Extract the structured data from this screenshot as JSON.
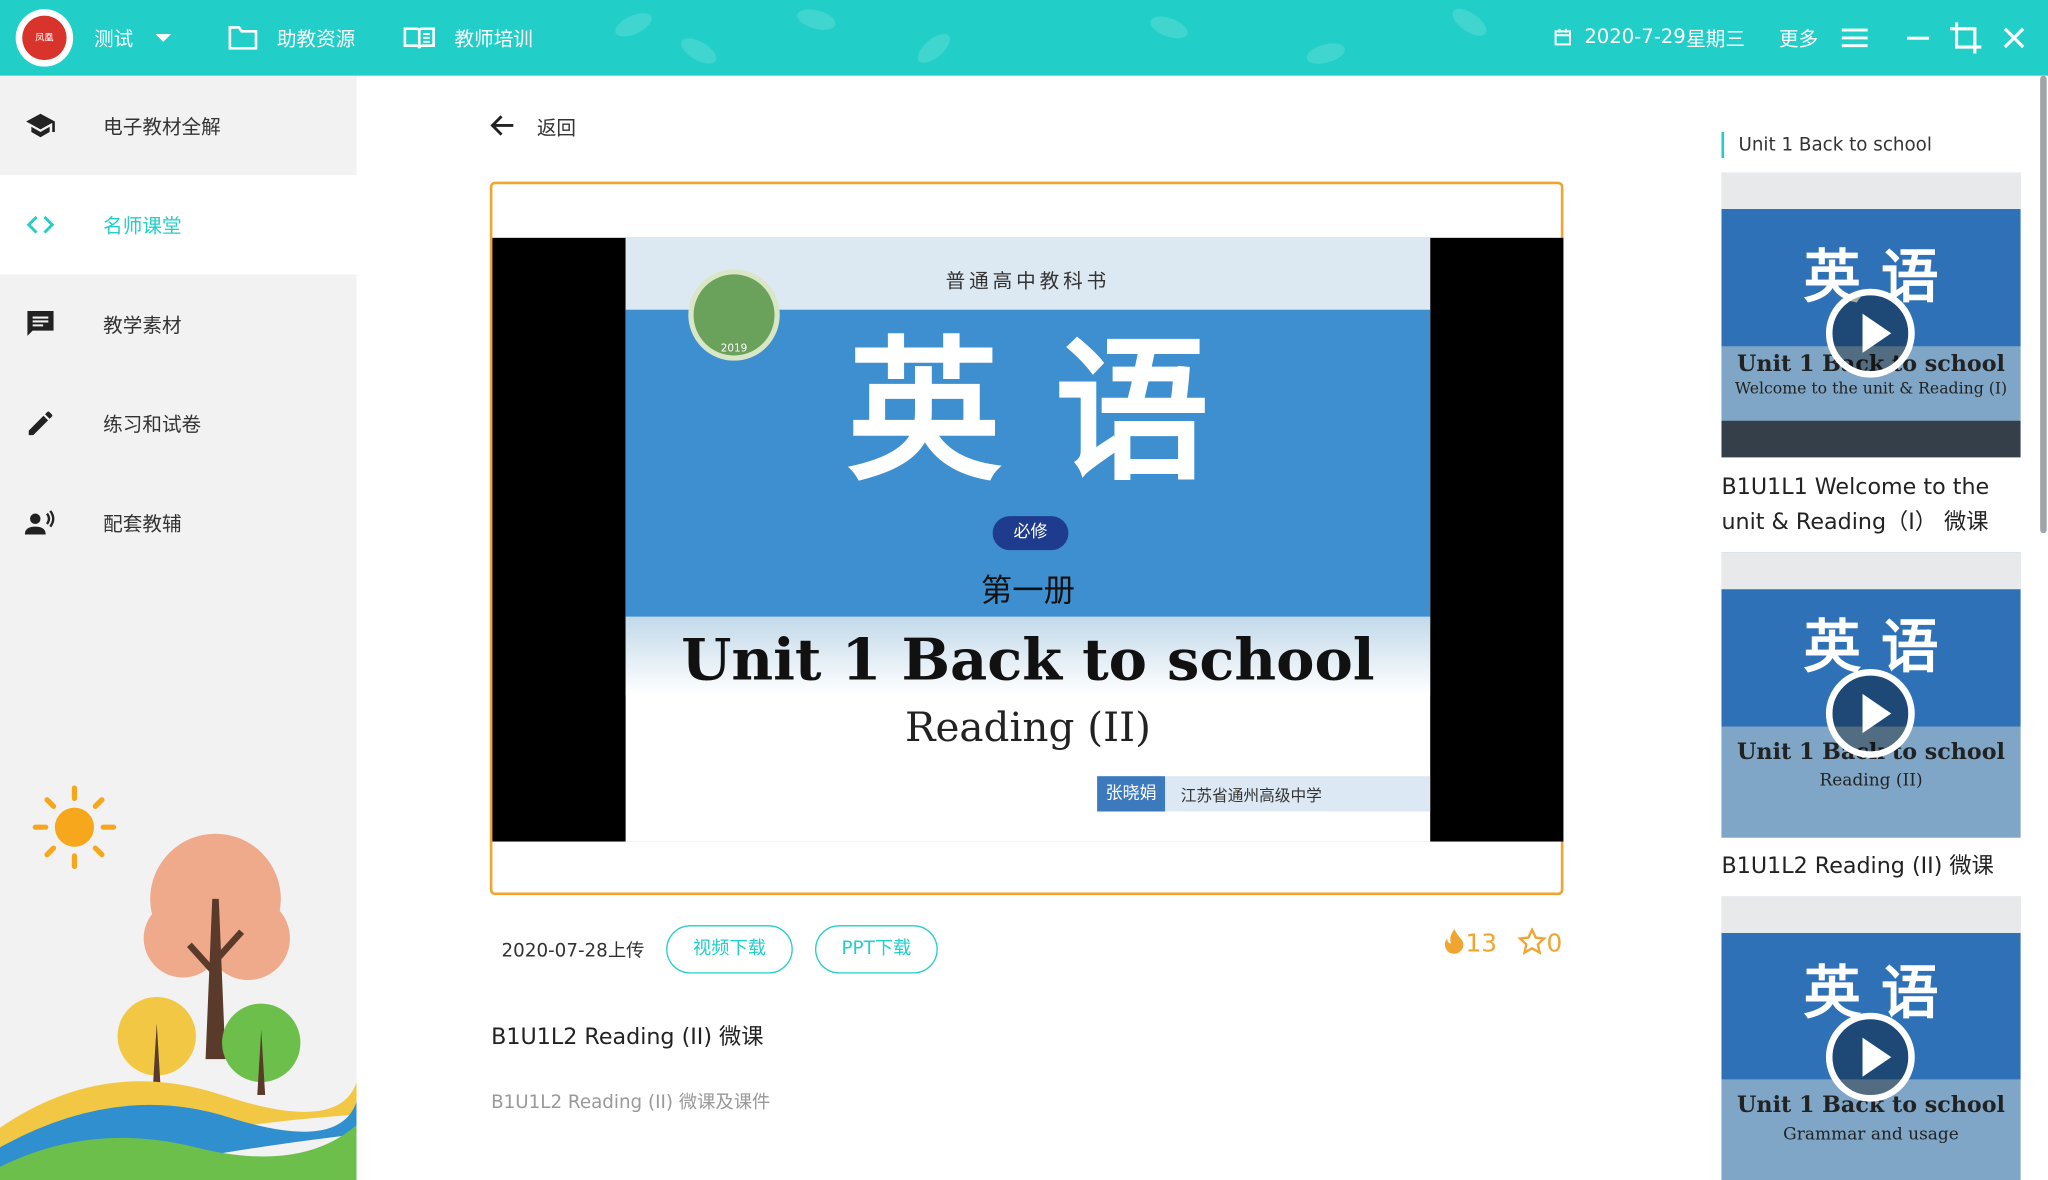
{
  "topbar": {
    "school_select": "测试",
    "resources_label": "助教资源",
    "training_label": "教师培训",
    "date": "2020-7-29",
    "weekday": "星期三",
    "more_label": "更多"
  },
  "sidebar": {
    "items": [
      {
        "label": "电子教材全解",
        "icon": "graduation-cap-icon"
      },
      {
        "label": "名师课堂",
        "icon": "code-brackets-icon"
      },
      {
        "label": "教学素材",
        "icon": "chat-bubble-icon"
      },
      {
        "label": "练习和试卷",
        "icon": "pencil-icon"
      },
      {
        "label": "配套教辅",
        "icon": "speaking-person-icon"
      }
    ],
    "active_index": 1
  },
  "main": {
    "back_label": "返回",
    "slide": {
      "header": "普通高中教科书",
      "subject": "英 语",
      "badge": "必修",
      "volume": "第一册",
      "unit_title": "Unit 1 Back to school",
      "lesson": "Reading (II)",
      "author": "张晓娟",
      "school": "江苏省通州高级中学"
    },
    "upload_date": "2020-07-28上传",
    "video_download_label": "视频下载",
    "ppt_download_label": "PPT下载",
    "views": "13",
    "favorites": "0",
    "title": "B1U1L2 Reading (II) 微课",
    "description": "B1U1L2 Reading (II) 微课及课件"
  },
  "right_panel": {
    "heading": "Unit 1 Back to school",
    "videos": [
      {
        "thumb_subject": "英 语",
        "thumb_unit": "Unit 1 Back to school",
        "thumb_sub": "Welcome to the unit & Reading (I)",
        "title": "B1U1L1 Welcome to the unit & Reading（I） 微课"
      },
      {
        "thumb_subject": "英 语",
        "thumb_unit": "Unit 1 Back to school",
        "thumb_sub": "Reading (II)",
        "title": "B1U1L2 Reading (II) 微课"
      },
      {
        "thumb_subject": "英 语",
        "thumb_unit": "Unit 1 Back to school",
        "thumb_sub": "Grammar and usage",
        "title": ""
      }
    ]
  },
  "colors": {
    "accent": "#22cfc8",
    "orange": "#f0a531",
    "sidebar_bg": "#f2f2f2"
  }
}
